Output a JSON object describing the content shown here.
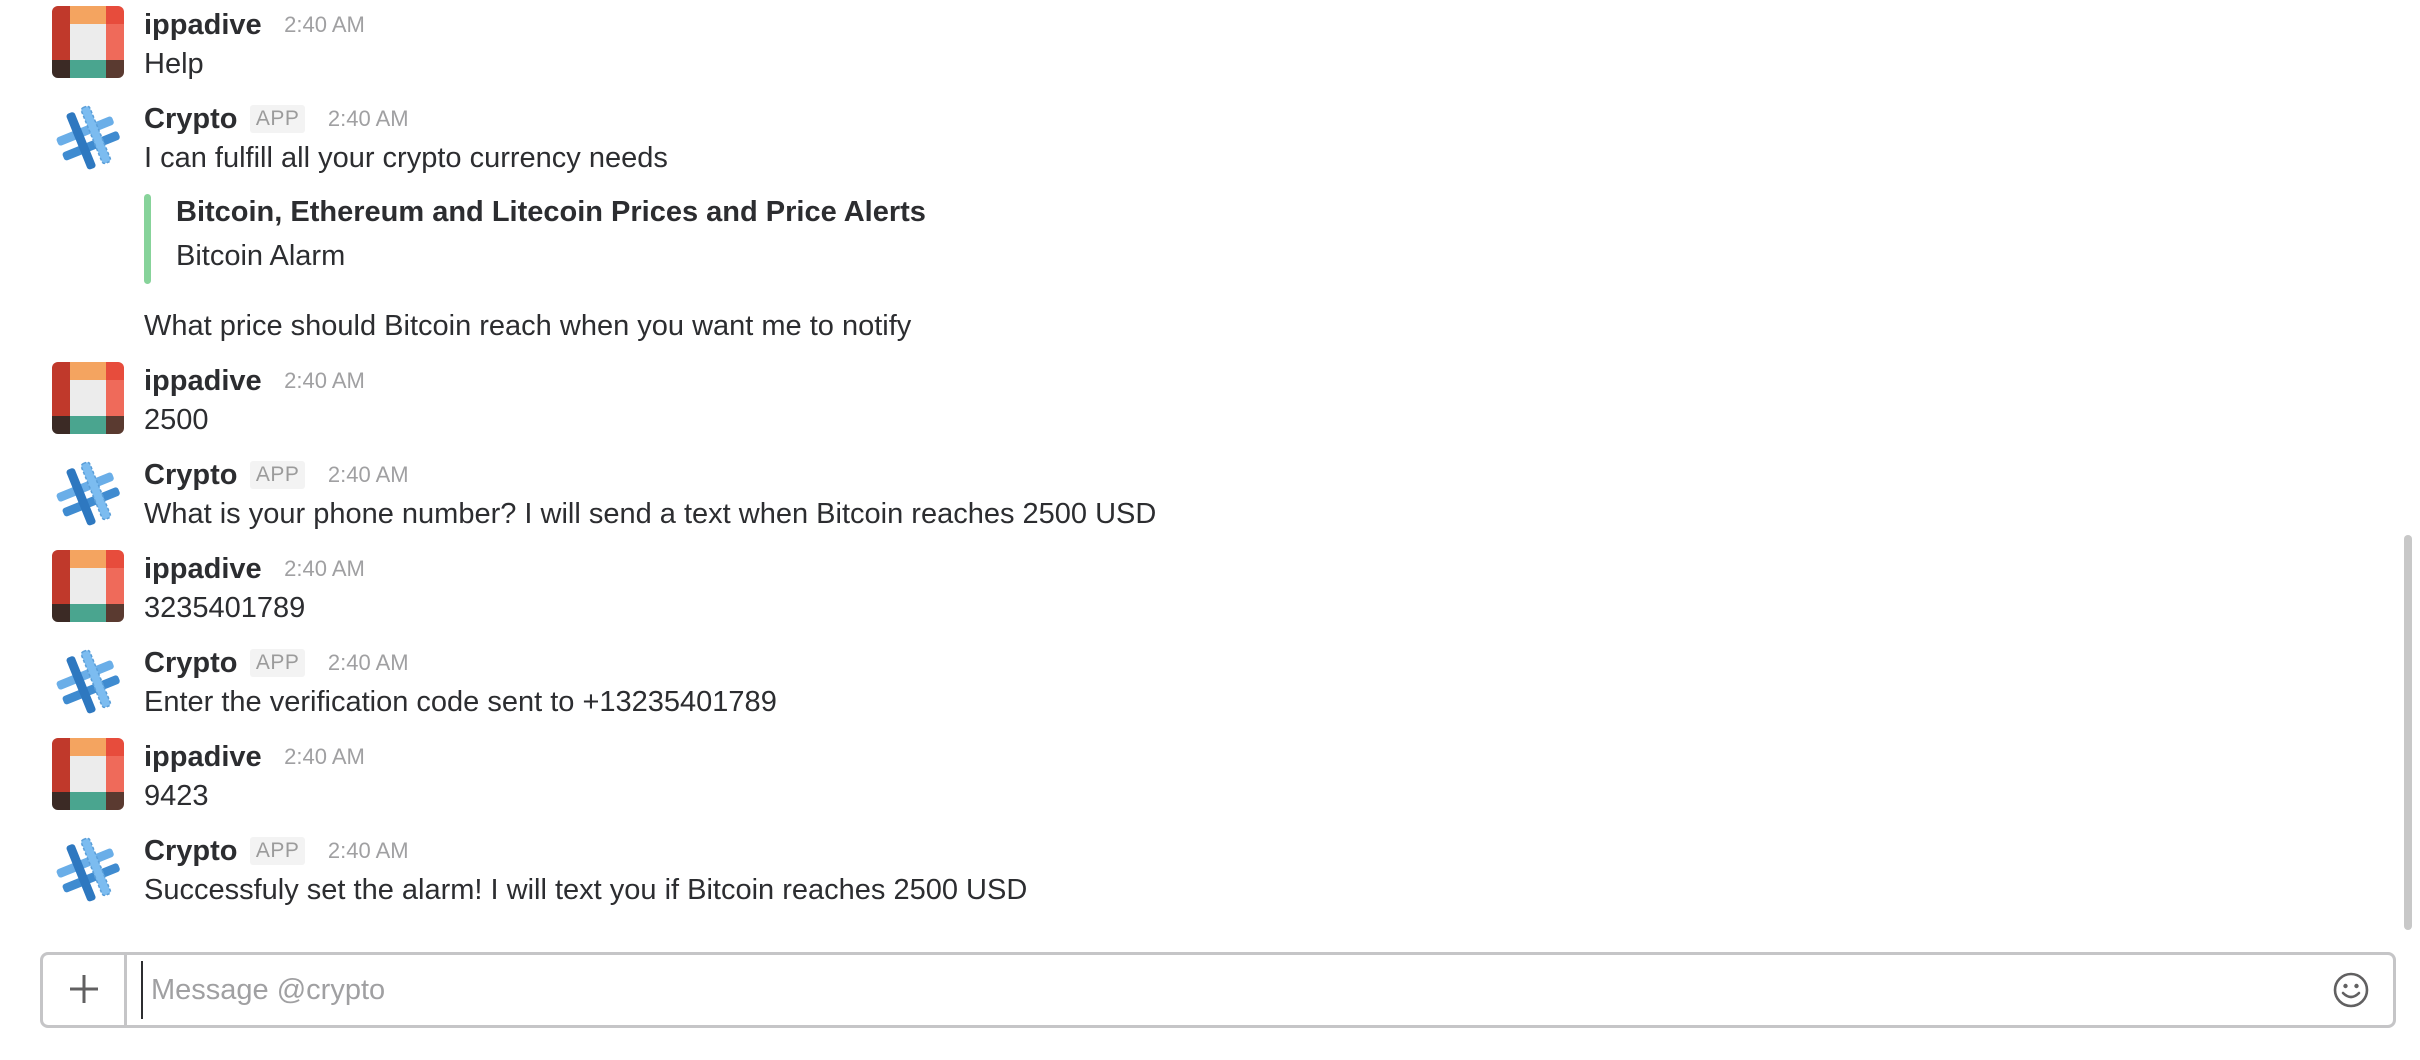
{
  "conversation": {
    "messages": [
      {
        "sender": "ippadive",
        "avatar_icon": "user-quilt-avatar",
        "is_app": false,
        "time": "2:40 AM",
        "lines": [
          "Help"
        ]
      },
      {
        "sender": "Crypto",
        "avatar_icon": "crypto-bot-avatar",
        "is_app": true,
        "badge": "APP",
        "time": "2:40 AM",
        "lines": [
          "I can fulfill all your crypto currency needs"
        ],
        "attachment": {
          "title": "Bitcoin, Ethereum and Litecoin Prices and Price Alerts",
          "text": "Bitcoin Alarm",
          "bar_color": "#87d39a"
        },
        "followup": "What price should Bitcoin reach when you want me to notify"
      },
      {
        "sender": "ippadive",
        "avatar_icon": "user-quilt-avatar",
        "is_app": false,
        "time": "2:40 AM",
        "lines": [
          "2500"
        ]
      },
      {
        "sender": "Crypto",
        "avatar_icon": "crypto-bot-avatar",
        "is_app": true,
        "badge": "APP",
        "time": "2:40 AM",
        "lines": [
          "What is your phone number? I will send a text when Bitcoin reaches 2500 USD"
        ]
      },
      {
        "sender": "ippadive",
        "avatar_icon": "user-quilt-avatar",
        "is_app": false,
        "time": "2:40 AM",
        "lines": [
          "3235401789"
        ]
      },
      {
        "sender": "Crypto",
        "avatar_icon": "crypto-bot-avatar",
        "is_app": true,
        "badge": "APP",
        "time": "2:40 AM",
        "lines": [
          "Enter the verification code sent to +13235401789"
        ]
      },
      {
        "sender": "ippadive",
        "avatar_icon": "user-quilt-avatar",
        "is_app": false,
        "time": "2:40 AM",
        "lines": [
          "9423"
        ]
      },
      {
        "sender": "Crypto",
        "avatar_icon": "crypto-bot-avatar",
        "is_app": true,
        "badge": "APP",
        "time": "2:40 AM",
        "lines": [
          "Successfuly set the alarm! I will text you if Bitcoin reaches 2500 USD"
        ]
      }
    ]
  },
  "composer": {
    "placeholder": "Message @crypto",
    "value": "",
    "plus_icon": "plus-icon",
    "emoji_icon": "emoji-icon"
  },
  "colors": {
    "attachment_bar": "#87d39a",
    "text": "#2c2d30",
    "muted": "#a0a0a2"
  }
}
